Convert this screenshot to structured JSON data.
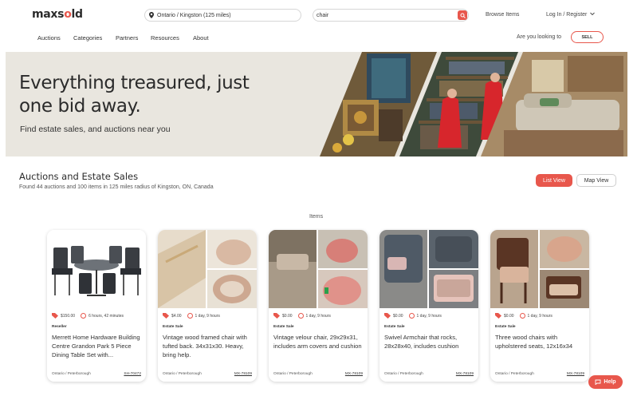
{
  "header": {
    "logo_prefix": "maxs",
    "logo_o": "o",
    "logo_suffix": "ld",
    "location_value": "Ontario / Kingston (125 miles)",
    "search_value": "chair",
    "browse_items": "Browse Items",
    "login": "Log In / Register",
    "looking_to": "Are you looking to",
    "sell": "SELL"
  },
  "nav": [
    "Auctions",
    "Categories",
    "Partners",
    "Resources",
    "About"
  ],
  "hero": {
    "title_line1": "Everything treasured, just",
    "title_line2": "one bid away.",
    "subtitle": "Find estate sales, and auctions near you"
  },
  "section": {
    "title": "Auctions and Estate Sales",
    "subtitle": "Found 44 auctions and 100 items in 125 miles radius of Kingston, ON, Canada",
    "list_view": "List View",
    "map_view": "Map View",
    "items_heading": "Items"
  },
  "cards": [
    {
      "price": "$150.00",
      "time": "6 hours, 42 minutes",
      "seller": "Reseller",
      "title": "Merrett Home Hardware Building Centre Grandon Park 5 Piece Dining Table Set with...",
      "location": "Ontario / Peterborough",
      "code": "SH-70472"
    },
    {
      "price": "$4.00",
      "time": "1 day, 9 hours",
      "seller": "Estate Sale",
      "title": "Vintage wood framed chair with tufted back. 34x31x30. Heavy, bring help.",
      "location": "Ontario / Peterborough",
      "code": "MX-78109"
    },
    {
      "price": "$0.00",
      "time": "1 day, 9 hours",
      "seller": "Estate Sale",
      "title": "Vintage velour chair, 29x29x31, includes arm covers and cushion",
      "location": "Ontario / Peterborough",
      "code": "MX-78109"
    },
    {
      "price": "$0.00",
      "time": "1 day, 9 hours",
      "seller": "Estate Sale",
      "title": "Swivel Armchair that rocks, 28x28x40, includes cushion",
      "location": "Ontario / Peterborough",
      "code": "MX-78109"
    },
    {
      "price": "$0.00",
      "time": "1 day, 9 hours",
      "seller": "Estate Sale",
      "title": "Three wood chairs with upholstered seats, 12x16x34",
      "location": "Ontario / Peterborough",
      "code": "MX-78109"
    }
  ],
  "help": "Help",
  "colors": {
    "accent": "#e8574c",
    "hero_bg": "#e9e6df"
  }
}
